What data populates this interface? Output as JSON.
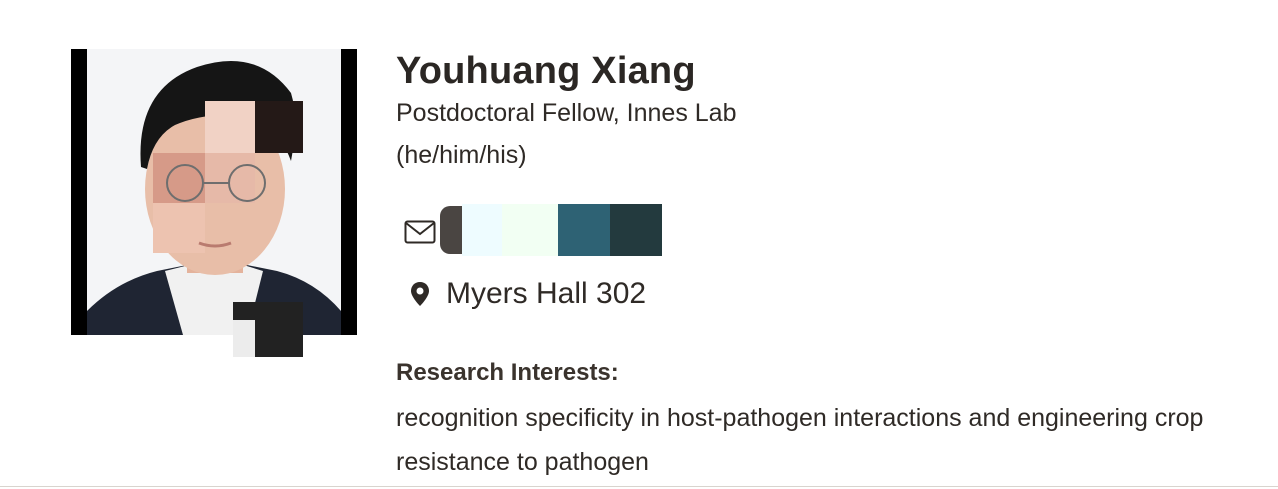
{
  "profile": {
    "name": "Youhuang Xiang",
    "title": "Postdoctoral Fellow, Innes Lab",
    "pronouns": "(he/him/his)",
    "email_icon": "envelope-icon",
    "email_text": "",
    "office_icon": "map-pin-icon",
    "office": "Myers Hall 302",
    "research_heading": "Research Interests:",
    "research_text": "recognition specificity in host-pathogen interactions and engineering crop resistance to pathogen"
  },
  "colors": {
    "text": "#2f2a26",
    "heading": "#2b2724",
    "photo_frame": "#000000"
  }
}
